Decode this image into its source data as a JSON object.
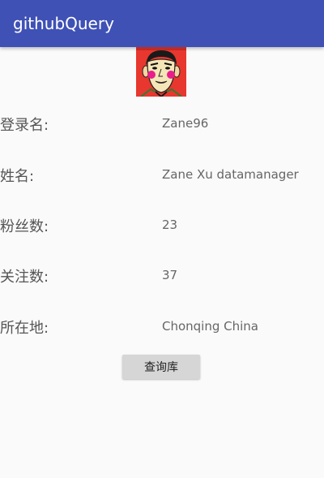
{
  "app": {
    "title": "githubQuery"
  },
  "profile": {
    "login_label": "登录名:",
    "login_value": "Zane96",
    "name_label": "姓名:",
    "name_value": "Zane Xu datamanager",
    "followers_label": "粉丝数:",
    "followers_value": "23",
    "following_label": "关注数:",
    "following_value": "37",
    "location_label": "所在地:",
    "location_value": "Chonqing China"
  },
  "actions": {
    "query_label": "查询库"
  },
  "colors": {
    "appbar": "#3f51b5",
    "background": "#fafafa",
    "button": "#d6d6d6"
  }
}
